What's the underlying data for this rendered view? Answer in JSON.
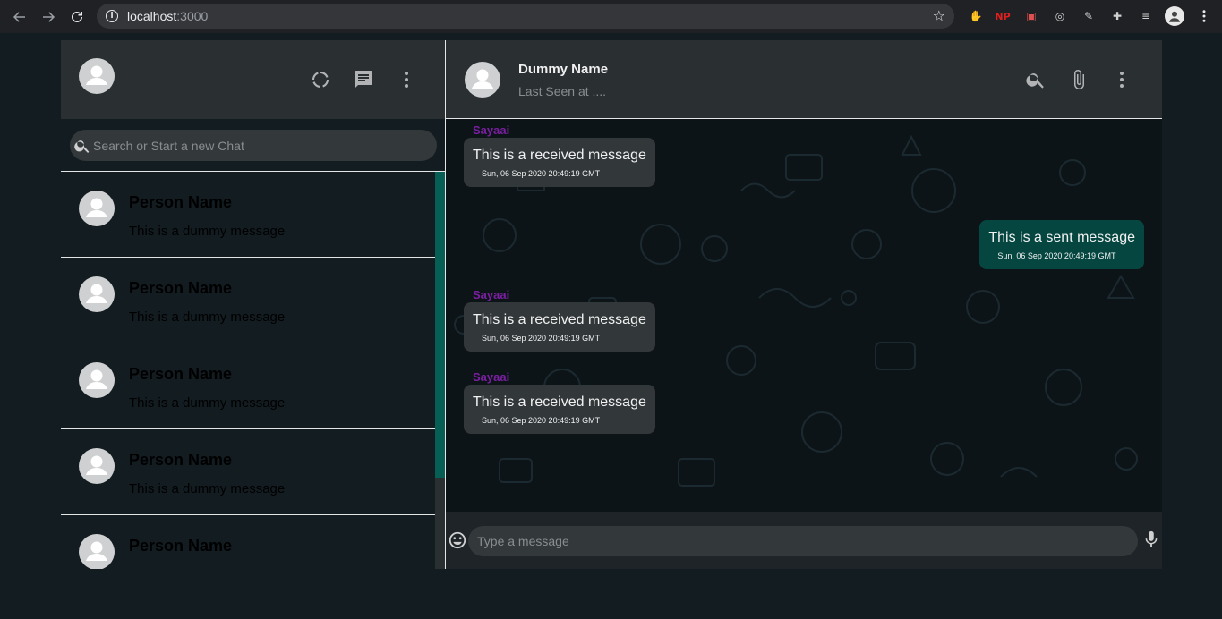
{
  "browser": {
    "url_host": "localhost",
    "url_port": ":3000",
    "extensions": [
      {
        "name": "adblock-icon",
        "label": "✋",
        "color": "#e02020"
      },
      {
        "name": "np-extension-icon",
        "label": "NP",
        "color": "#e02020"
      },
      {
        "name": "puzzle-red-extension-icon",
        "label": "▣",
        "color": "#e05050"
      },
      {
        "name": "target-extension-icon",
        "label": "◎",
        "color": "#d0d0d0"
      },
      {
        "name": "pen-extension-icon",
        "label": "✎",
        "color": "#d0d0d0"
      },
      {
        "name": "extensions-icon",
        "label": "✚",
        "color": "#d0d0d0"
      },
      {
        "name": "media-control-icon",
        "label": "≡",
        "color": "#d0d0d0"
      }
    ]
  },
  "sidebar": {
    "search_placeholder": "Search or Start a new Chat",
    "chats": [
      {
        "name": "Person Name",
        "message": "This is a dummy message"
      },
      {
        "name": "Person Name",
        "message": "This is a dummy message"
      },
      {
        "name": "Person Name",
        "message": "This is a dummy message"
      },
      {
        "name": "Person Name",
        "message": "This is a dummy message"
      },
      {
        "name": "Person Name",
        "message": "This is a dummy message"
      }
    ]
  },
  "chat": {
    "title": "Dummy Name",
    "subtitle": "Last Seen at ....",
    "messages": [
      {
        "type": "received",
        "sender": "Sayaai",
        "text": "This is a received message",
        "time": "Sun, 06 Sep 2020 20:49:19 GMT"
      },
      {
        "type": "sent",
        "sender": "",
        "text": "This is a sent message",
        "time": "Sun, 06 Sep 2020 20:49:19 GMT"
      },
      {
        "type": "received",
        "sender": "Sayaai",
        "text": "This is a received message",
        "time": "Sun, 06 Sep 2020 20:49:19 GMT"
      },
      {
        "type": "received",
        "sender": "Sayaai",
        "text": "This is a received message",
        "time": "Sun, 06 Sep 2020 20:49:19 GMT"
      }
    ],
    "input_placeholder": "Type a message"
  },
  "colors": {
    "accent": "#075e54",
    "sent_bubble": "#054740",
    "received_bubble": "#323739",
    "sender_name": "#7b1fa2",
    "panel": "#2a2f32",
    "background": "#131c21"
  }
}
